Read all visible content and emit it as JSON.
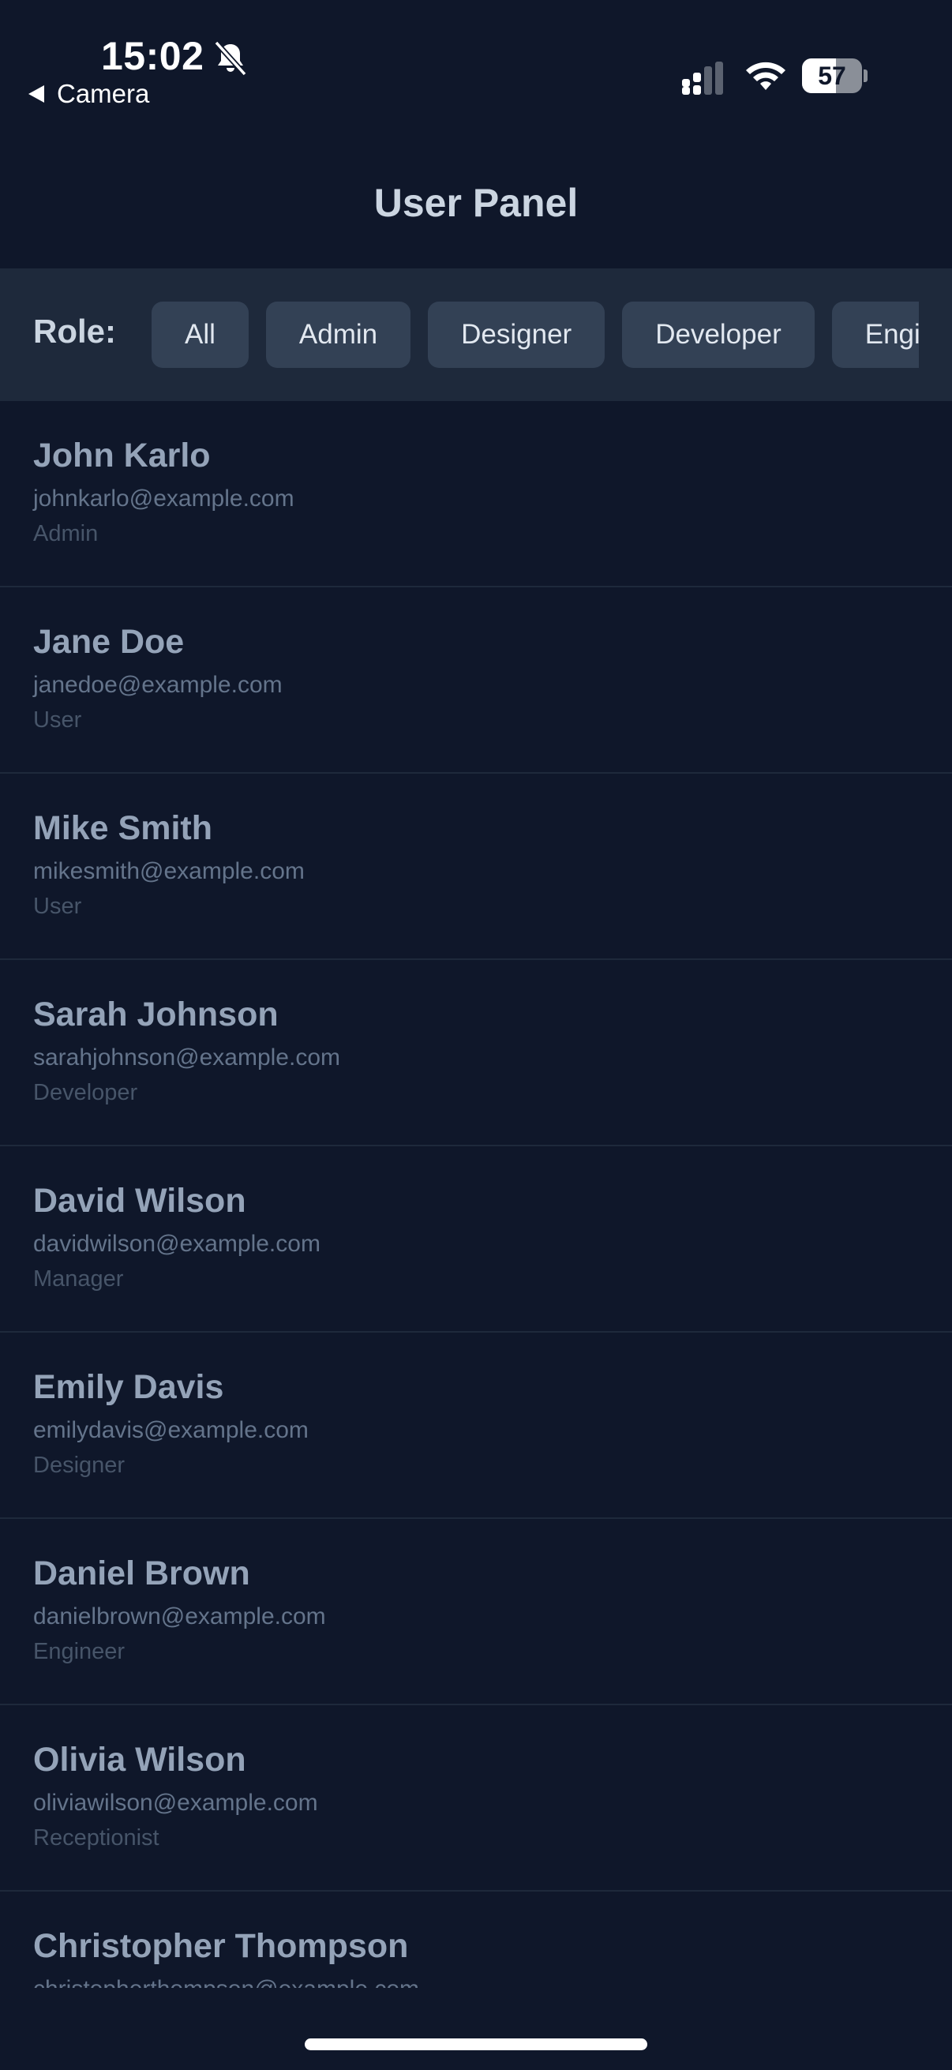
{
  "status_bar": {
    "time": "15:02",
    "back_label": "Camera",
    "battery_percent": "57",
    "battery_level": 0.57,
    "icons": [
      "bell-slash-icon",
      "cellular-signal-icon",
      "wifi-icon",
      "battery-icon"
    ]
  },
  "header": {
    "title": "User Panel"
  },
  "filter": {
    "label": "Role:",
    "chips": [
      "All",
      "Admin",
      "Designer",
      "Developer",
      "Engineer"
    ]
  },
  "users": [
    {
      "name": "John Karlo",
      "email": "johnkarlo@example.com",
      "role": "Admin"
    },
    {
      "name": "Jane Doe",
      "email": "janedoe@example.com",
      "role": "User"
    },
    {
      "name": "Mike Smith",
      "email": "mikesmith@example.com",
      "role": "User"
    },
    {
      "name": "Sarah Johnson",
      "email": "sarahjohnson@example.com",
      "role": "Developer"
    },
    {
      "name": "David Wilson",
      "email": "davidwilson@example.com",
      "role": "Manager"
    },
    {
      "name": "Emily Davis",
      "email": "emilydavis@example.com",
      "role": "Designer"
    },
    {
      "name": "Daniel Brown",
      "email": "danielbrown@example.com",
      "role": "Engineer"
    },
    {
      "name": "Olivia Wilson",
      "email": "oliviawilson@example.com",
      "role": "Receptionist"
    },
    {
      "name": "Christopher Thompson",
      "email": "christopherthompson@example.com",
      "role": ""
    }
  ],
  "colors": {
    "background": "#0f172a",
    "filter_bar": "#1e293b",
    "chip": "#334155",
    "name_text": "#94a3b8",
    "email_text": "#64748b",
    "role_text": "#475569"
  }
}
